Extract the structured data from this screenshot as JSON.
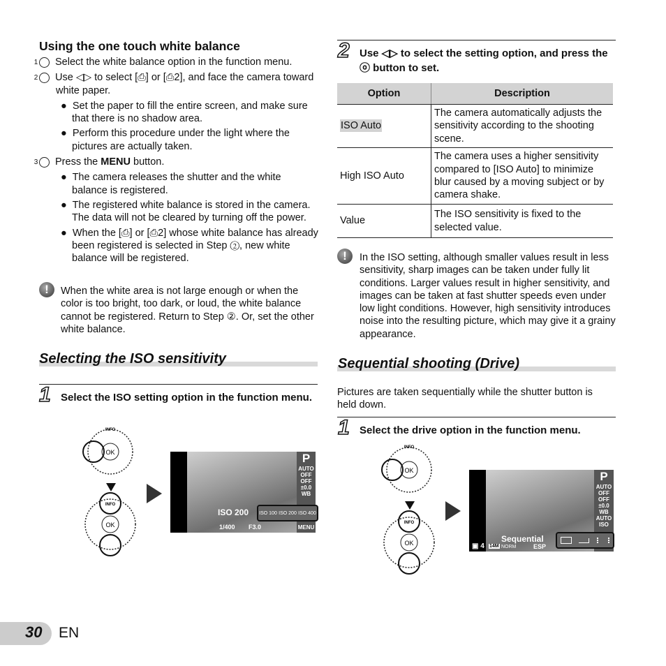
{
  "left": {
    "wb_heading": "Using the one touch white balance",
    "wb_steps": [
      {
        "num": "1",
        "text": "Select the white balance option in the function menu."
      },
      {
        "num": "2",
        "text": "Use ◁▷ to select [⎙] or [⎙2], and face the camera toward white paper."
      },
      {
        "num": "3",
        "text_before": "Press the ",
        "menu_word": "MENU",
        "text_after": " button."
      }
    ],
    "step2_bullets": [
      "Set the paper to fill the entire screen, and make sure that there is no shadow area.",
      "Perform this procedure under the light where the pictures are actually taken."
    ],
    "step3_bullets": [
      "The camera releases the shutter and the white balance is registered.",
      "The registered white balance is stored in the camera. The data will not be cleared by turning off the power.",
      "When the [⎙] or [⎙2] whose white balance has already been registered is selected in Step ②, new white balance will be registered."
    ],
    "caution": "When the white area is not large enough or when the color is too bright, too dark, or loud, the white balance cannot be registered. Return to Step ②. Or, set the other white balance.",
    "iso_heading": "Selecting the ISO sensitivity",
    "iso_step_num": "1",
    "iso_step": "Select the ISO setting option in the function menu.",
    "screen": {
      "mode": "P",
      "label": "ISO 200",
      "options": [
        "ISO 100",
        "ISO 200",
        "ISO 400"
      ],
      "shutter": "1/400",
      "aperture": "F3.0",
      "icons": [
        "AUTO",
        "OFF",
        "OFF",
        "±0.0",
        "WB",
        "MENU"
      ]
    },
    "dial_labels": {
      "info": "INFO",
      "ok": "OK"
    }
  },
  "right": {
    "step2_num": "2",
    "step2_text": "Use ◁▷ to select the setting option, and press the ⓞ button to set.",
    "table": {
      "headers": [
        "Option",
        "Description"
      ],
      "rows": [
        [
          "ISO Auto",
          "The camera automatically adjusts the sensitivity according to the shooting scene."
        ],
        [
          "High ISO Auto",
          "The camera uses a higher sensitivity compared to [ISO Auto] to minimize blur caused by a moving subject or by camera shake."
        ],
        [
          "Value",
          "The ISO sensitivity is fixed to the selected value."
        ]
      ]
    },
    "caution": "In the ISO setting, although smaller values result in less sensitivity, sharp images can be taken under fully lit conditions. Larger values result in higher sensitivity, and images can be taken at fast shutter speeds even under low light conditions. However, high sensitivity introduces noise into the resulting picture, which may give it a grainy appearance.",
    "drive_heading": "Sequential shooting (Drive)",
    "drive_intro": "Pictures are taken sequentially while the shutter button is held down.",
    "drive_step_num": "1",
    "drive_step": "Select the drive option in the function menu.",
    "screen": {
      "mode": "P",
      "label": "Sequential",
      "bottom_left": "4",
      "size": "14M",
      "quality": "NORM",
      "metering": "ESP",
      "icons": [
        "AUTO",
        "OFF",
        "OFF",
        "±0.0",
        "WB AUTO",
        "ISO"
      ]
    }
  },
  "footer": {
    "page": "30",
    "lang": "EN"
  }
}
